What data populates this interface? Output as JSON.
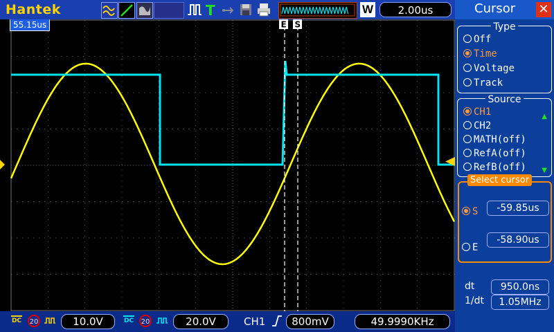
{
  "brand": "Hantek",
  "toolbar": {
    "icons": [
      "waveform-icon",
      "ramp-icon",
      "persistence-icon",
      "pulse-icon",
      "trigger-icon",
      "usb-icon",
      "disk-icon",
      "printer-icon"
    ],
    "trigger_letter": "T",
    "usb_label": "usb",
    "memory_indicator": "waveform-memory-icon",
    "w_badge": "W",
    "timebase": "2.00us"
  },
  "scope": {
    "trigger_position": "55.15us",
    "cursor_e_label": "E",
    "cursor_s_label": "S",
    "colors": {
      "ch1": "#ffff00",
      "ch2": "#00e5f0",
      "grid": "#555555",
      "cursor": "#ffffff"
    }
  },
  "panel": {
    "title": "Cursor",
    "close_icon": "close-icon",
    "type_group": {
      "title": "Type",
      "options": [
        {
          "label": "Off",
          "selected": false
        },
        {
          "label": "Time",
          "selected": true
        },
        {
          "label": "Voltage",
          "selected": false
        },
        {
          "label": "Track",
          "selected": false
        }
      ]
    },
    "source_group": {
      "title": "Source",
      "options": [
        {
          "label": "CH1",
          "selected": true
        },
        {
          "label": "CH2",
          "selected": false
        },
        {
          "label": "MATH(off)",
          "selected": false
        },
        {
          "label": "RefA(off)",
          "selected": false
        },
        {
          "label": "RefB(off)",
          "selected": false
        }
      ]
    },
    "select_cursor": {
      "title": "Select cursor",
      "s_label": "S",
      "s_value": "-59.85us",
      "e_label": "E",
      "e_value": "-58.90us"
    },
    "dt_label": "dt",
    "dt_value": "950.0ns",
    "inv_dt_label": "1/dt",
    "inv_dt_value": "1.05MHz"
  },
  "bottom": {
    "ch1_coupling": "DC",
    "ch1_bw": "20",
    "ch1_scale": "10.0V",
    "ch2_coupling": "DC",
    "ch2_bw": "20",
    "ch2_scale": "20.0V",
    "trigger_source": "CH1",
    "trigger_level": "800mV",
    "frequency": "49.9990KHz"
  }
}
